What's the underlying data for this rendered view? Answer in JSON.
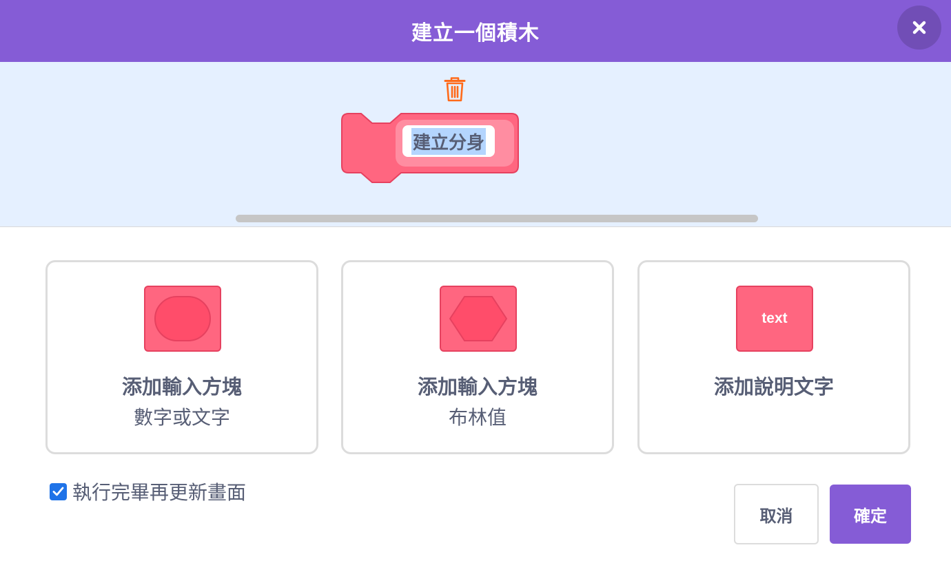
{
  "header": {
    "title": "建立一個積木",
    "close_icon": "close-icon"
  },
  "workspace": {
    "trash_icon": "trash-icon",
    "block_name": "建立分身",
    "colors": {
      "block": "#ff6680",
      "block_border": "#e6415f",
      "background": "#e5f0ff"
    }
  },
  "options": [
    {
      "title": "添加輸入方塊",
      "subtitle": "數字或文字",
      "icon": "round-input-icon"
    },
    {
      "title": "添加輸入方塊",
      "subtitle": "布林值",
      "icon": "boolean-input-icon"
    },
    {
      "title": "添加說明文字",
      "icon": "label-text-icon",
      "icon_text": "text"
    }
  ],
  "footer": {
    "run_without_refresh_label": "執行完畢再更新畫面",
    "run_without_refresh_checked": true,
    "cancel_label": "取消",
    "ok_label": "確定"
  },
  "colors": {
    "accent": "#855cd6",
    "text": "#575e75",
    "checkbox": "#1f73e8"
  }
}
